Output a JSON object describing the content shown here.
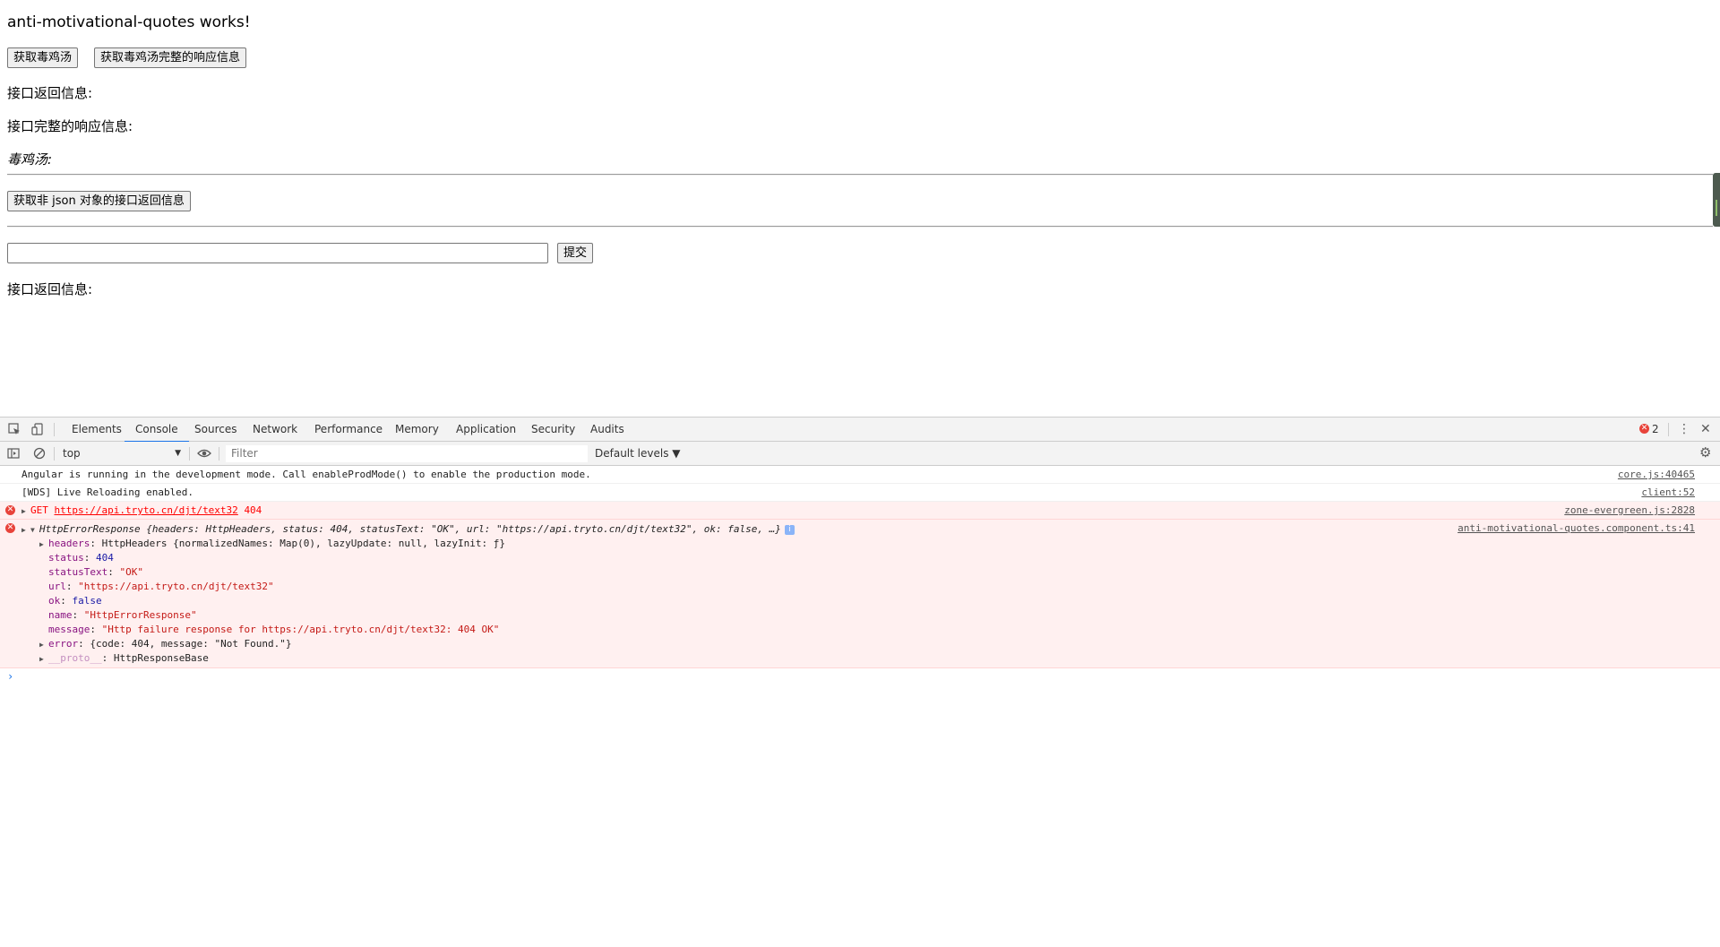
{
  "page": {
    "title": "anti-motivational-quotes works!",
    "btn_get_quote": "获取毒鸡汤",
    "btn_get_full_response": "获取毒鸡汤完整的响应信息",
    "label_api_return": "接口返回信息:",
    "label_full_response": "接口完整的响应信息:",
    "label_quote": "毒鸡汤:",
    "btn_get_non_json": "获取非 json 对象的接口返回信息",
    "input_value": "",
    "btn_submit": "提交",
    "label_api_return_2": "接口返回信息:"
  },
  "devtools": {
    "tabs": [
      "Elements",
      "Console",
      "Sources",
      "Network",
      "Performance",
      "Memory",
      "Application",
      "Security",
      "Audits"
    ],
    "active_tab": "Console",
    "error_count": "2",
    "context": "top",
    "filter_placeholder": "Filter",
    "levels": "Default levels ▼",
    "messages": [
      {
        "text": "Angular is running in the development mode. Call enableProdMode() to enable the production mode.",
        "source": "core.js:40465"
      },
      {
        "text": "[WDS] Live Reloading enabled.",
        "source": "client:52"
      },
      {
        "method": "GET",
        "url": "https://api.tryto.cn/djt/text32",
        "status": "404",
        "source": "zone-evergreen.js:2828"
      }
    ],
    "error_object": {
      "summary_name": "HttpErrorResponse",
      "summary_rest": "{headers: HttpHeaders, status: 404, statusText: \"OK\", url: \"https://api.tryto.cn/djt/text32\", ok: false, …}",
      "source": "anti-motivational-quotes.component.ts:41",
      "props": [
        {
          "key": "headers",
          "value": "HttpHeaders {normalizedNames: Map(0), lazyUpdate: null, lazyInit: ƒ}"
        },
        {
          "key": "status",
          "value": "404"
        },
        {
          "key": "statusText",
          "value": "\"OK\""
        },
        {
          "key": "url",
          "value": "\"https://api.tryto.cn/djt/text32\""
        },
        {
          "key": "ok",
          "value": "false"
        },
        {
          "key": "name",
          "value": "\"HttpErrorResponse\""
        },
        {
          "key": "message",
          "value": "\"Http failure response for https://api.tryto.cn/djt/text32: 404 OK\""
        },
        {
          "key": "error",
          "value": "{code: 404, message: \"Not Found.\"}"
        },
        {
          "key": "__proto__",
          "value": "HttpResponseBase"
        }
      ]
    }
  }
}
